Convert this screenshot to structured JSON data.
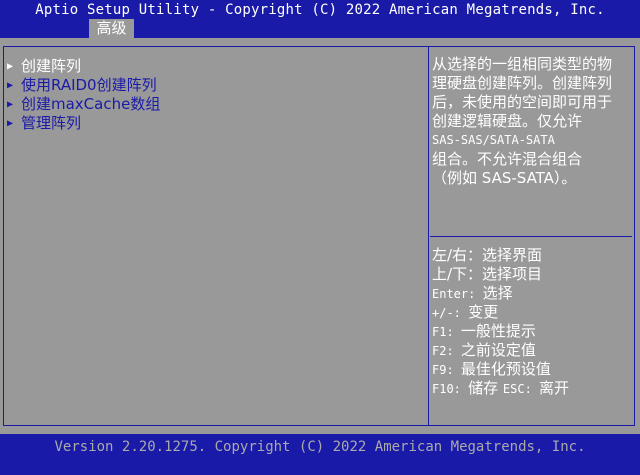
{
  "header": {
    "title": "Aptio Setup Utility - Copyright (C) 2022 American Megatrends, Inc.",
    "tab_label": "高级"
  },
  "menu": {
    "items": [
      {
        "label": "创建阵列",
        "selected": true
      },
      {
        "label": "使用RAID0创建阵列",
        "selected": false
      },
      {
        "label": "创建maxCache数组",
        "selected": false
      },
      {
        "label": "管理阵列",
        "selected": false
      }
    ]
  },
  "help": {
    "lines": [
      "从选择的一组相同类型的物",
      "理硬盘创建阵列。创建阵列",
      "后，未使用的空间即可用于",
      "创建逻辑硬盘。仅允许",
      "SAS-SAS/SATA-SATA",
      "组合。不允许混合组合",
      "（例如 SAS-SATA）。"
    ]
  },
  "keys": {
    "lines": [
      {
        "key": "",
        "desc": "左/右：选择界面"
      },
      {
        "key": "",
        "desc": "上/下：选择项目"
      },
      {
        "key": "Enter: ",
        "desc": "选择"
      },
      {
        "key": "+/-: ",
        "desc": "变更"
      },
      {
        "key": "F1: ",
        "desc": "一般性提示"
      },
      {
        "key": "F2: ",
        "desc": "之前设定值"
      },
      {
        "key": "F9: ",
        "desc": "最佳化预设值"
      },
      {
        "key": "F10: ",
        "desc": "储存  ",
        "key2": "ESC: ",
        "desc2": "离开"
      }
    ]
  },
  "footer": {
    "text": "Version 2.20.1275. Copyright (C) 2022 American Megatrends, Inc."
  },
  "colors": {
    "bar": "#1a1aa8",
    "background": "#999999",
    "selected_text": "#ffffff",
    "item_text": "#1a1aa8"
  }
}
